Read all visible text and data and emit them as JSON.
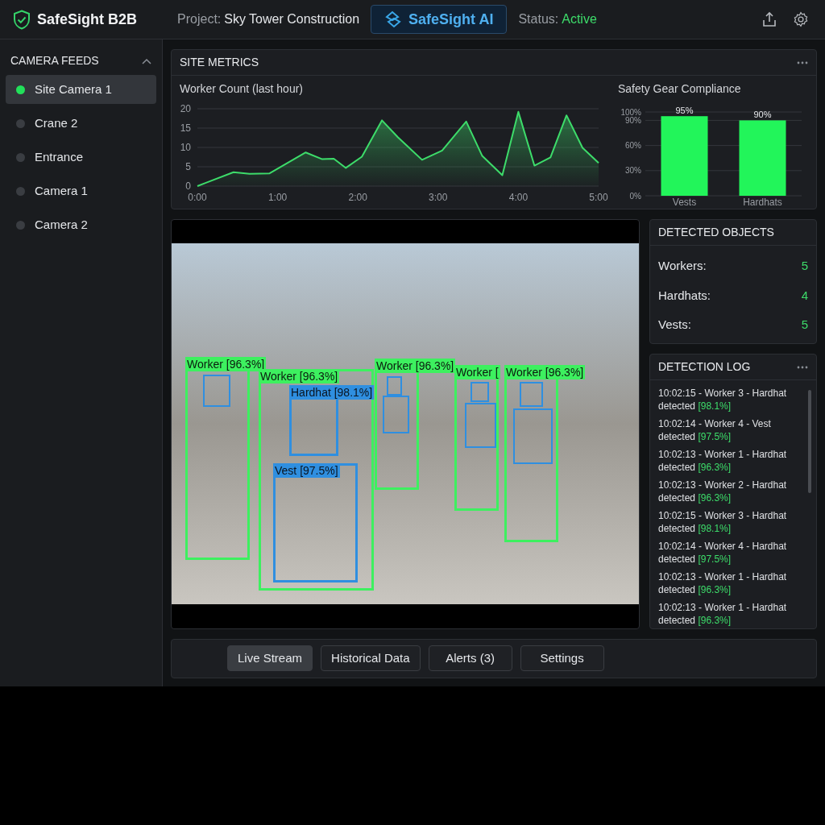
{
  "header": {
    "brand": "SafeSight B2B",
    "project_label": "Project:",
    "project_name": "Sky Tower Construction",
    "badge": "SafeSight AI",
    "status_label": "Status:",
    "status_value": "Active"
  },
  "sidebar": {
    "title": "CAMERA FEEDS",
    "items": [
      {
        "label": "Site Camera 1",
        "selected": true
      },
      {
        "label": "Crane 2",
        "selected": false
      },
      {
        "label": "Entrance",
        "selected": false
      },
      {
        "label": "Camera 1",
        "selected": false
      },
      {
        "label": "Camera 2",
        "selected": false
      }
    ]
  },
  "site_metrics": {
    "title": "SITE METRICS",
    "worker_chart": {
      "chart_data": {
        "type": "area",
        "title": "Worker Count (last hour)",
        "x": [
          0,
          0.45,
          0.65,
          0.9,
          1.35,
          1.55,
          1.7,
          1.85,
          2.05,
          2.3,
          2.5,
          2.8,
          3.05,
          3.35,
          3.55,
          3.8,
          4.0,
          4.2,
          4.4,
          4.6,
          4.8,
          5.0
        ],
        "grid": true,
        "series": [
          {
            "color": "#3ddc6a",
            "values": [
              0,
              3.6,
              3.2,
              3.3,
              8.7,
              7,
              7.1,
              4.7,
              7.6,
              17,
              12.6,
              6.8,
              9.2,
              16.7,
              7.8,
              2.8,
              19.2,
              5.3,
              7.4,
              18.3,
              9.9,
              6
            ]
          }
        ],
        "xlim": [
          0,
          5
        ],
        "ylim": [
          0,
          20
        ],
        "xticks": [
          {
            "value": 0,
            "label": "0:00"
          },
          {
            "value": 1,
            "label": "1:00"
          },
          {
            "value": 2,
            "label": "2:00"
          },
          {
            "value": 3,
            "label": "3:00"
          },
          {
            "value": 4,
            "label": "4:00"
          },
          {
            "value": 5,
            "label": "5:00"
          }
        ],
        "yticks": [
          0,
          5,
          10,
          15,
          20
        ]
      }
    },
    "compliance_chart": {
      "chart_data": {
        "type": "bar",
        "title": "Safety Gear Compliance",
        "categories": [
          "Vests",
          "Hardhats"
        ],
        "grid": true,
        "series": [
          {
            "color": "#22f55a",
            "values": [
              95,
              90
            ]
          }
        ],
        "ylim": [
          0,
          100
        ],
        "yticks": [
          {
            "value": 0,
            "label": "0%"
          },
          {
            "value": 30,
            "label": "30%"
          },
          {
            "value": 60,
            "label": "60%"
          },
          {
            "value": 90,
            "label": "90%"
          },
          {
            "value": 100,
            "label": "100%"
          }
        ],
        "value_labels": [
          "95%",
          "90%"
        ]
      }
    }
  },
  "video": {
    "detections": [
      {
        "kind": "worker",
        "label": "Worker [96.3%]"
      },
      {
        "kind": "worker",
        "label": "Worker [96.3%]"
      },
      {
        "kind": "worker",
        "label": "Worker [96.3%]"
      },
      {
        "kind": "worker",
        "label": "Worker ["
      },
      {
        "kind": "worker",
        "label": "Worker [96.3%]"
      },
      {
        "kind": "gear",
        "label": "Hardhat [98.1%]"
      },
      {
        "kind": "gear",
        "label": "Vest [97.5%]"
      }
    ]
  },
  "detected_objects": {
    "title": "DETECTED OBJECTS",
    "rows": [
      {
        "label": "Workers:",
        "value": "5"
      },
      {
        "label": "Hardhats:",
        "value": "4"
      },
      {
        "label": "Vests:",
        "value": "5"
      }
    ]
  },
  "detection_log": {
    "title": "DETECTION LOG",
    "entries": [
      {
        "text": "10:02:15 - Worker 3 - Hardhat detected",
        "confidence": "[98.1%]"
      },
      {
        "text": "10:02:14 - Worker 4 - Vest detected",
        "confidence": "[97.5%]"
      },
      {
        "text": "10:02:13 - Worker 1 - Hardhat detected",
        "confidence": "[96.3%]"
      },
      {
        "text": "10:02:13 - Worker 2 - Hardhat detected",
        "confidence": "[96.3%]"
      },
      {
        "text": "10:02:15 - Worker 3 - Hardhat detected",
        "confidence": "[98.1%]"
      },
      {
        "text": "10:02:14 - Worker 4 - Hardhat detected",
        "confidence": "[97.5%]"
      },
      {
        "text": "10:02:13 - Worker 1 - Hardhat detected",
        "confidence": "[96.3%]"
      },
      {
        "text": "10:02:13 - Worker 1 - Hardhat detected",
        "confidence": "[96.3%]"
      }
    ]
  },
  "tabs": [
    {
      "label": "Live Stream",
      "selected": true
    },
    {
      "label": "Historical Data",
      "selected": false
    },
    {
      "label": "Alerts (3)",
      "selected": false
    },
    {
      "label": "Settings",
      "selected": false
    }
  ]
}
